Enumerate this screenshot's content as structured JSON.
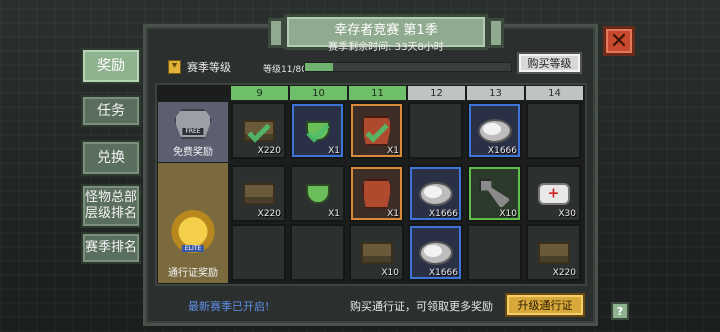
{
  "side_menu": [
    {
      "label": "奖励",
      "active": true
    },
    {
      "label": "任务",
      "active": false
    },
    {
      "label": "兑换",
      "active": false
    },
    {
      "label": "怪物总部层级排名",
      "active": false
    },
    {
      "label": "赛季排名",
      "active": false
    }
  ],
  "header": {
    "title": "幸存者竞赛 第1季",
    "subtitle": "赛季剩余时间: 33天8小时"
  },
  "season_level": {
    "label": "赛季等级",
    "level_text": "等级11/80",
    "progress_fraction": 0.1375
  },
  "buy_level_label": "购买等级",
  "columns": [
    {
      "label": "9",
      "unlocked": true
    },
    {
      "label": "10",
      "unlocked": true
    },
    {
      "label": "11",
      "unlocked": true
    },
    {
      "label": "12",
      "unlocked": false
    },
    {
      "label": "13",
      "unlocked": false
    },
    {
      "label": "14",
      "unlocked": false
    }
  ],
  "rows": {
    "free": {
      "tag": "FREE",
      "label": "免费奖励"
    },
    "elite": {
      "tag": "ELITE",
      "label": "通行证奖励"
    }
  },
  "cells": {
    "free": [
      {
        "item": "crate-icon",
        "qty": "X220",
        "claimed": true,
        "rarity": "none"
      },
      {
        "item": "cup-icon",
        "qty": "X1",
        "claimed": true,
        "rarity": "blue"
      },
      {
        "item": "armor-icon",
        "qty": "X1",
        "claimed": true,
        "rarity": "orange"
      },
      {
        "item": "",
        "qty": "",
        "claimed": false,
        "rarity": "none"
      },
      {
        "item": "coin-icon",
        "qty": "X1666",
        "claimed": false,
        "rarity": "blue"
      },
      {
        "item": "",
        "qty": "",
        "claimed": false,
        "rarity": "none"
      }
    ],
    "elite_1": [
      {
        "item": "crate-icon",
        "qty": "X220",
        "claimed": false,
        "rarity": "none"
      },
      {
        "item": "cup-icon",
        "qty": "X1",
        "claimed": false,
        "rarity": "none"
      },
      {
        "item": "armor-icon",
        "qty": "X1",
        "claimed": false,
        "rarity": "orange"
      },
      {
        "item": "coin-icon",
        "qty": "X1666",
        "claimed": false,
        "rarity": "blue"
      },
      {
        "item": "wrench-icon",
        "qty": "X10",
        "claimed": false,
        "rarity": "green"
      },
      {
        "item": "medkit-icon",
        "qty": "X30",
        "claimed": false,
        "rarity": "none"
      }
    ],
    "elite_2": [
      {
        "item": "",
        "qty": "",
        "claimed": false,
        "rarity": "none"
      },
      {
        "item": "",
        "qty": "",
        "claimed": false,
        "rarity": "none"
      },
      {
        "item": "crate-icon",
        "qty": "X10",
        "claimed": false,
        "rarity": "none"
      },
      {
        "item": "coin-icon",
        "qty": "X1666",
        "claimed": false,
        "rarity": "blue"
      },
      {
        "item": "",
        "qty": "",
        "claimed": false,
        "rarity": "none"
      },
      {
        "item": "crate-icon",
        "qty": "X220",
        "claimed": false,
        "rarity": "none"
      }
    ]
  },
  "footer": {
    "new_season": "最新赛季已开启!",
    "buy_pass_text": "购买通行证，可领取更多奖励",
    "upgrade_pass_label": "升级通行证",
    "help": "?"
  },
  "close_glyph": "✕"
}
